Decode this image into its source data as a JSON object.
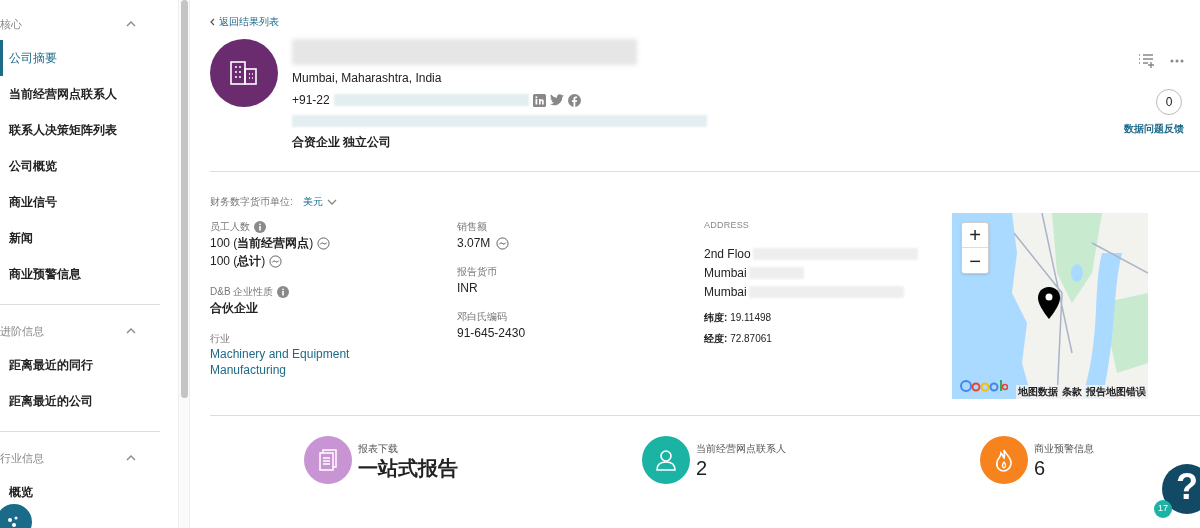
{
  "sidebar": {
    "sections": [
      {
        "title": "核心",
        "expanded": true,
        "items": [
          {
            "label": "公司摘要",
            "selected": true
          },
          {
            "label": "当前经营网点联系人",
            "selected": false
          },
          {
            "label": "联系人决策矩阵列表",
            "selected": false
          },
          {
            "label": "公司概览",
            "selected": false
          },
          {
            "label": "商业信号",
            "selected": false
          },
          {
            "label": "新闻",
            "selected": false
          },
          {
            "label": "商业预警信息",
            "selected": false
          }
        ]
      },
      {
        "title": "进阶信息",
        "expanded": true,
        "items": [
          {
            "label": "距离最近的同行",
            "selected": false
          },
          {
            "label": "距离最近的公司",
            "selected": false
          }
        ]
      },
      {
        "title": "行业信息",
        "expanded": true,
        "items": [
          {
            "label": "概览",
            "selected": false
          }
        ]
      }
    ]
  },
  "back_link": "返回结果列表",
  "company": {
    "location": "Mumbai, Maharashtra,  India",
    "phone": "+91-22",
    "types": "合资企业 独立公司"
  },
  "feedback": {
    "count": "0",
    "label": "数据问题反馈"
  },
  "currency": {
    "label": "财务数字货币单位:",
    "value": "美元"
  },
  "col1": {
    "employees_label": "员工人数",
    "employees": [
      "100 (**当前经营网点**)",
      "100 (**总计**)"
    ],
    "nature_label": "D&B 企业性质",
    "nature": "合伙企业",
    "industry_label": "行业",
    "industry": "Machinery and Equipment Manufacturing"
  },
  "col2": [
    {
      "label": "销售额",
      "value": "3.07M",
      "trend": true
    },
    {
      "label": "报告货币",
      "value": "INR",
      "trend": false
    },
    {
      "label": "邓白氏编码",
      "value": "91-645-2430",
      "trend": false
    }
  ],
  "address": {
    "label": "ADDRESS",
    "lines": [
      "2nd Floo",
      "Mumbai",
      "Mumbai"
    ],
    "lat_label": "纬度:",
    "lat": "19.11498",
    "lng_label": "经度:",
    "lng": "72.87061"
  },
  "map": {
    "zoom_in": "+",
    "zoom_out": "−",
    "attribution": [
      "地图数据",
      "条款",
      "报告地图错误"
    ]
  },
  "stats": [
    {
      "kind": "report",
      "label": "报表下载",
      "value": "一站式报告",
      "color": "#c994d4"
    },
    {
      "kind": "contacts",
      "label": "当前经营网点联系人",
      "value": "2",
      "color": "#1bb3a4"
    },
    {
      "kind": "alerts",
      "label": "商业预警信息",
      "value": "6",
      "color": "#f7831e"
    }
  ],
  "help": {
    "symbol": "?",
    "badge": "17"
  }
}
